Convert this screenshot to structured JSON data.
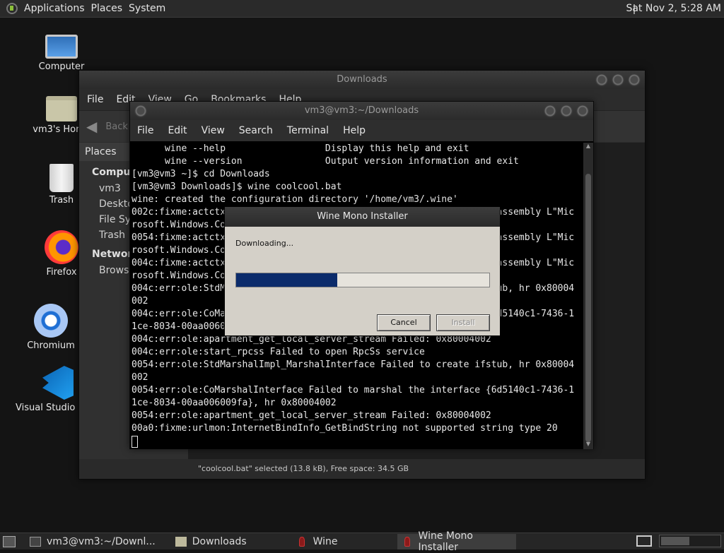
{
  "topbar": {
    "menu": [
      "Applications",
      "Places",
      "System"
    ],
    "clock": "Sat Nov  2,  5:28 AM"
  },
  "desktop_icons": [
    {
      "label": "Computer",
      "icon": "monitor-icon"
    },
    {
      "label": "vm3's Home",
      "icon": "home-folder-icon"
    },
    {
      "label": "Trash",
      "icon": "trash-icon"
    },
    {
      "label": "Firefox",
      "icon": "firefox-icon"
    },
    {
      "label": "Chromium",
      "icon": "chromium-icon"
    },
    {
      "label": "Visual Studio Code",
      "icon": "vscode-icon"
    }
  ],
  "file_manager": {
    "title": "Downloads",
    "menu": [
      "File",
      "Edit",
      "View",
      "Go",
      "Bookmarks",
      "Help"
    ],
    "back_label": "Back",
    "sidebar_header": "Places",
    "sidebar_groups": [
      {
        "label": "Computer",
        "items": [
          "vm3",
          "Desktop",
          "File System",
          "Trash"
        ]
      },
      {
        "label": "Network",
        "items": [
          "Browse Network"
        ]
      }
    ],
    "status": "\"coolcool.bat\" selected (13.8 kB), Free space: 34.5 GB"
  },
  "terminal": {
    "title": "vm3@vm3:~/Downloads",
    "menu": [
      "File",
      "Edit",
      "View",
      "Search",
      "Terminal",
      "Help"
    ],
    "lines": [
      "      wine --help                  Display this help and exit",
      "      wine --version               Output version information and exit",
      "[vm3@vm3 ~]$ cd Downloads",
      "[vm3@vm3 Downloads]$ wine coolcool.bat",
      "wine: created the configuration directory '/home/vm3/.wine'",
      "002c:fixme:actctx:parse_depend_manifests Could not find dependent assembly L\"Mic",
      "rosoft.Windows.Common-Controls\" (6.0.0.0)",
      "0054:fixme:actctx:parse_depend_manifests Could not find dependent assembly L\"Mic",
      "rosoft.Windows.Common-Controls\" (6.0.0.0)",
      "004c:fixme:actctx:parse_depend_manifests Could not find dependent assembly L\"Mic",
      "rosoft.Windows.Common-Controls\" (6.0.0.0)",
      "004c:err:ole:StdMarshalImpl_MarshalInterface Failed to create ifstub, hr 0x80004",
      "002",
      "004c:err:ole:CoMarshalInterface Failed to marshal the interface {6d5140c1-7436-1",
      "1ce-8034-00aa006009fa}, hr 0x80004002",
      "004c:err:ole:apartment_get_local_server_stream Failed: 0x80004002",
      "004c:err:ole:start_rpcss Failed to open RpcSs service",
      "0054:err:ole:StdMarshalImpl_MarshalInterface Failed to create ifstub, hr 0x80004",
      "002",
      "0054:err:ole:CoMarshalInterface Failed to marshal the interface {6d5140c1-7436-1",
      "1ce-8034-00aa006009fa}, hr 0x80004002",
      "0054:err:ole:apartment_get_local_server_stream Failed: 0x80004002",
      "00a0:fixme:urlmon:InternetBindInfo_GetBindString not supported string type 20"
    ]
  },
  "dialog": {
    "title": "Wine Mono Installer",
    "status": "Downloading...",
    "progress": 0.4,
    "cancel_label": "Cancel",
    "install_label": "Install"
  },
  "taskbar": {
    "tasks": [
      {
        "label": "vm3@vm3:~/Downl...",
        "icon": "terminal-icon"
      },
      {
        "label": "Downloads",
        "icon": "folder-icon"
      },
      {
        "label": "Wine",
        "icon": "wine-icon"
      },
      {
        "label": "Wine Mono Installer",
        "icon": "wine-icon",
        "active": true
      }
    ]
  },
  "colors": {
    "progress_fill": "#0b2b6b",
    "dialog_bg": "#d4d0c8"
  }
}
